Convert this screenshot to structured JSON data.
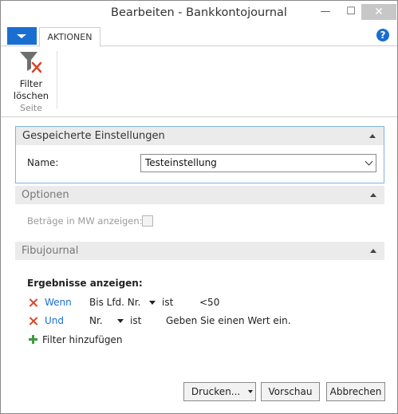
{
  "window": {
    "title": "Bearbeiten - Bankkontojournal",
    "minimize": "—",
    "maximize": "☐",
    "close": "✕"
  },
  "ribbon": {
    "tab": "AKTIONEN",
    "help": "?",
    "filter_button": {
      "line1": "Filter",
      "line2": "löschen",
      "icon": "clear-filter-icon"
    },
    "group_label": "Seite"
  },
  "saved_settings": {
    "header": "Gespeicherte Einstellungen",
    "name_label": "Name:",
    "name_value": "Testeinstellung"
  },
  "options": {
    "header": "Optionen",
    "lcy_label": "Beträge in MW anzeigen:",
    "lcy_checked": false
  },
  "fibujournal": {
    "header": "Fibujournal",
    "results_label": "Ergebnisse anzeigen:",
    "filters": [
      {
        "connector": "Wenn",
        "field": "Bis Lfd. Nr.",
        "op": "ist",
        "value": "<50"
      },
      {
        "connector": "Und",
        "field": "Nr.",
        "op": "ist",
        "value": "Geben Sie einen Wert ein."
      }
    ],
    "add_filter": "Filter hinzufügen"
  },
  "footer": {
    "print": "Drucken...",
    "preview": "Vorschau",
    "cancel": "Abbrechen"
  },
  "colors": {
    "accent": "#1a6ed0",
    "remove": "#d8462a",
    "add": "#3c9a3c"
  }
}
